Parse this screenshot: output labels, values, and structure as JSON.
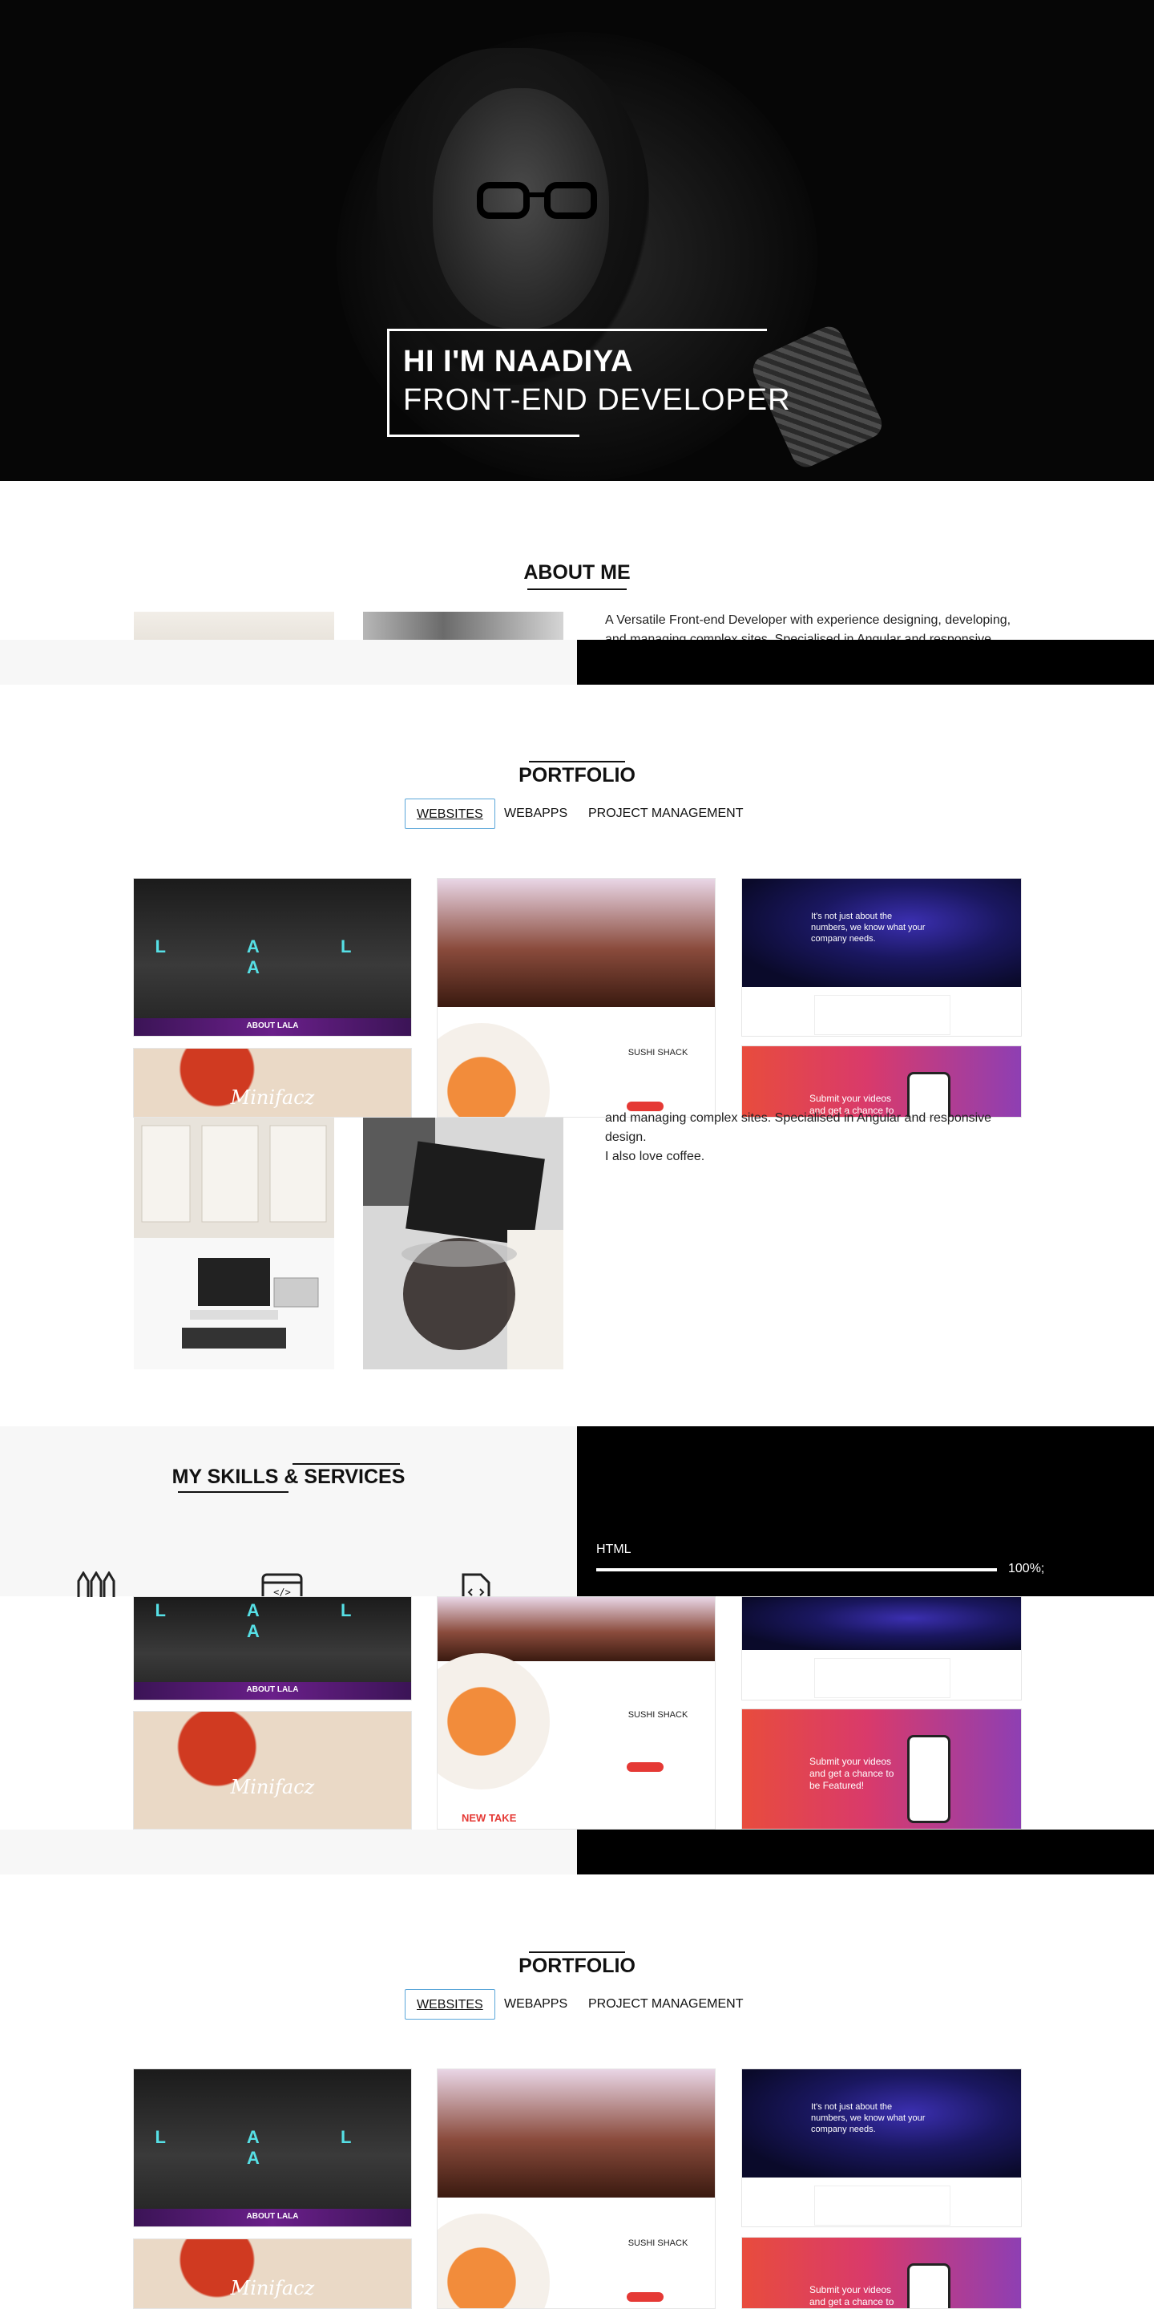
{
  "hero": {
    "name": "HI I'M NAADIYA",
    "role": "FRONT-END DEVELOPER"
  },
  "about": {
    "title": "ABOUT ME",
    "text_line1": "A Versatile Front-end Developer with experience designing, developing,",
    "text_line2": "and managing complex sites. Specialised in Angular and responsive",
    "text_line3": "design.",
    "text_line4": "I also love coffee."
  },
  "portfolio": {
    "title": "PORTFOLIO",
    "tabs": [
      "WEBSITES",
      "WEBAPPS",
      "PROJECT MANAGEMENT"
    ],
    "active_tab": "WEBSITES",
    "cards": {
      "lala_letters": "L A L A",
      "lala_bar": "ABOUT LALA",
      "minifacz": "Minifacz",
      "sushi_logo": "SUSHI SHACK",
      "sushi_newtake": "NEW TAKE",
      "net_text": "It's not just about the numbers, we know what your company needs.",
      "sub_text": "Submit your videos and get a chance to be Featured!"
    }
  },
  "skills": {
    "title": "MY SKILLS & SERVICES",
    "bar_label": "HTML",
    "bar_value": "100%;",
    "bar_fraction": 1.0
  }
}
